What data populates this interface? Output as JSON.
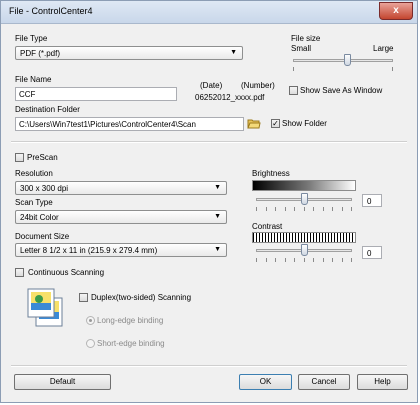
{
  "window": {
    "title": "File - ControlCenter4",
    "close_label": "x"
  },
  "file_type": {
    "label": "File Type",
    "selected": "PDF (*.pdf)"
  },
  "file_size": {
    "label": "File size",
    "small_label": "Small",
    "large_label": "Large",
    "level": 0.55
  },
  "file_name": {
    "label": "File Name",
    "value": "CCF",
    "date_header": "(Date)",
    "number_header": "(Number)",
    "suffix_preview": "06252012_xxxx.pdf"
  },
  "show_save_as_window": {
    "label": "Show Save As Window",
    "checked": false
  },
  "destination": {
    "label": "Destination Folder",
    "value": "C:\\Users\\Win7test1\\Pictures\\ControlCenter4\\Scan",
    "browse_icon": "folder-browse-icon",
    "show_folder_label": "Show Folder",
    "show_folder_checked": true
  },
  "prescan": {
    "label": "PreScan",
    "checked": false
  },
  "resolution": {
    "label": "Resolution",
    "selected": "300 x 300 dpi"
  },
  "scan_type": {
    "label": "Scan Type",
    "selected": "24bit Color"
  },
  "document_size": {
    "label": "Document Size",
    "selected": "Letter 8 1/2 x 11 in (215.9 x 279.4 mm)"
  },
  "continuous_scanning": {
    "label": "Continuous Scanning",
    "checked": false
  },
  "brightness": {
    "label": "Brightness",
    "value": "0",
    "level": 0.5
  },
  "contrast": {
    "label": "Contrast",
    "value": "0",
    "level": 0.5
  },
  "duplex": {
    "label": "Duplex(two-sided) Scanning",
    "checked": false,
    "icon": "duplex-pages-icon",
    "long_edge_label": "Long-edge binding",
    "short_edge_label": "Short-edge binding"
  },
  "buttons": {
    "default": "Default",
    "ok": "OK",
    "cancel": "Cancel",
    "help": "Help"
  }
}
